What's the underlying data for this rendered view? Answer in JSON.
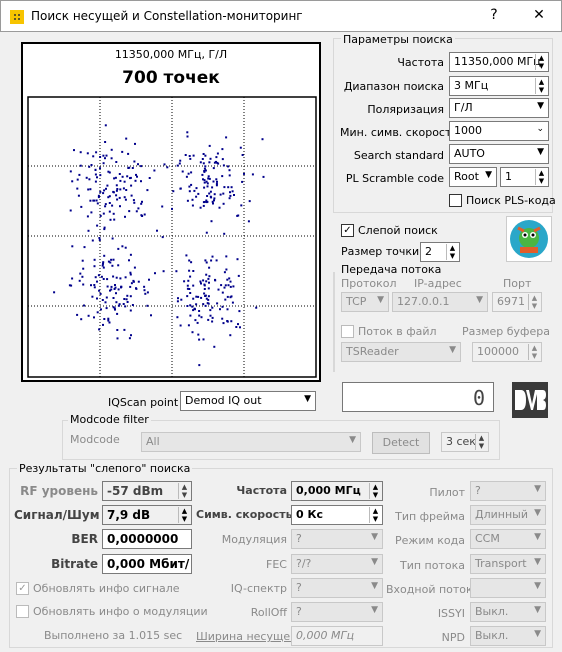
{
  "window": {
    "title": "Поиск несущей и Constellation-мониторинг",
    "help": "?",
    "close": "✕"
  },
  "plot": {
    "freq_label": "11350,000 МГц, Г/Л",
    "points_label": "700 точек"
  },
  "params": {
    "group": "Параметры поиска",
    "freq_label": "Частота",
    "freq_value": "11350,000 МГц",
    "range_label": "Диапазон поиска",
    "range_value": "3 МГц",
    "pol_label": "Поляризация",
    "pol_value": "Г/Л",
    "minsym_label": "Мин. симв. скорость",
    "minsym_value": "1000",
    "std_label": "Search standard",
    "std_value": "AUTO",
    "pls_label": "PL Scramble code",
    "pls_mode": "Root",
    "pls_value": "1",
    "plssearch_label": "Поиск PLS-кода"
  },
  "blind": {
    "label": "Слепой поиск",
    "checked": "✓",
    "pointsize_label": "Размер точки",
    "pointsize_value": "2"
  },
  "stream": {
    "group": "Передача потока",
    "proto_label": "Протокол",
    "ip_label": "IP-адрес",
    "port_label": "Порт",
    "proto_value": "TCP",
    "ip_value": "127.0.0.1",
    "port_value": "6971",
    "tofile_label": "Поток в файл",
    "buf_label": "Размер буфера",
    "reader_value": "TSReader",
    "buf_value": "100000"
  },
  "display": {
    "value": "0"
  },
  "iqscan": {
    "label": "IQScan point",
    "value": "Demod IQ out"
  },
  "modcode": {
    "group": "Modcode filter",
    "label": "Modcode",
    "value": "All",
    "detect": "Detect",
    "sec": "3 сек"
  },
  "results": {
    "group": "Результаты \"слепого\" поиска",
    "rf_label": "RF уровень",
    "rf_value": "-57 dBm",
    "snr_label": "Сигнал/Шум",
    "snr_value": "7,9 dB",
    "ber_label": "BER",
    "ber_value": "0,0000000",
    "bitrate_label": "Bitrate",
    "bitrate_value": "0,000 Мбит/",
    "upd_signal": "Обновлять инфо сигнале",
    "upd_mod": "Обновлять инфо о модуляции",
    "done": "Выполнено за 1.015 sec",
    "freq_label": "Частота",
    "freq_value": "0,000 МГц",
    "sym_label": "Симв. скорость",
    "sym_value": "0 Кс",
    "mod_label": "Модуляция",
    "mod_value": "?",
    "fec_label": "FEC",
    "fec_value": "?/?",
    "iq_label": "IQ-спектр",
    "iq_value": "?",
    "rolloff_label": "RollOff",
    "rolloff_value": "?",
    "bw_label": "Ширина несущей",
    "bw_value": "0,000 МГц",
    "pilot_label": "Пилот",
    "pilot_value": "?",
    "frame_label": "Тип фрейма",
    "frame_value": "Длинный",
    "codemode_label": "Режим кода",
    "codemode_value": "CCM",
    "streamtype_label": "Тип потока",
    "streamtype_value": "Transport",
    "instream_label": "Входной поток",
    "instream_value": "",
    "issyi_label": "ISSYI",
    "issyi_value": "Выкл.",
    "npd_label": "NPD",
    "npd_value": "Выкл."
  },
  "colors": {
    "points": "#00008b"
  }
}
